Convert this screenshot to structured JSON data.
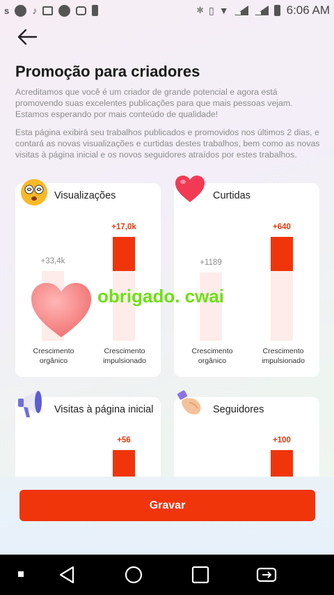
{
  "status_bar": {
    "left_icons": [
      "s-icon",
      "circle-icon",
      "tiktok-icon",
      "gallery-icon",
      "circle-icon",
      "cast-icon",
      "battery-saver-icon"
    ],
    "right_icons": [
      "bluetooth-icon",
      "vibrate-icon",
      "wifi-icon",
      "signal-icon",
      "signal-icon",
      "battery-icon"
    ],
    "time": "6:06 AM"
  },
  "header": {
    "back_icon": "arrow-left-icon",
    "title": "Promoção para criadores",
    "description_1": "Acreditamos que você é um criador de grande potencial e agora está promovendo suas excelentes publicações para que mais pessoas vejam. Estamos esperando por mais conteúdo de qualidade!",
    "description_2": "Esta página exibirá seu trabalhos publicados e promovidos nos últimos 2 dias, e contará as novas visualizações e curtidas destes trabalhos, bem como as novas visitas à página inicial e os novos seguidores atraídos por estes trabalhos."
  },
  "cards": [
    {
      "title": "Visualizações",
      "icon": "dizzy-face-emoji-icon",
      "organic": {
        "label": "+33,4k",
        "fraction": 0.66
      },
      "boosted": {
        "label": "+17,0k",
        "fraction": 1.0
      },
      "caption_organic": [
        "Crescimento",
        "orgânico"
      ],
      "caption_boosted": [
        "Crescimento",
        "impulsionado"
      ]
    },
    {
      "title": "Curtidas",
      "icon": "heart-emoji-icon",
      "organic": {
        "label": "+1189",
        "fraction": 0.66
      },
      "boosted": {
        "label": "+640",
        "fraction": 1.0
      },
      "caption_organic": [
        "Crescimento",
        "orgânico"
      ],
      "caption_boosted": [
        "Crescimento",
        "impulsionado"
      ]
    },
    {
      "title": "Visitas à página inicial",
      "icon": "megaphone-icon",
      "boosted": {
        "label": "+56"
      }
    },
    {
      "title": "Seguidores",
      "icon": "handshake-icon",
      "boosted": {
        "label": "+100"
      }
    }
  ],
  "watermark": {
    "text": "obrigado. cwai",
    "icon": "heart-icon",
    "color": "#6ee011"
  },
  "actions": {
    "save_label": "Gravar"
  },
  "nav_bar": {
    "items": [
      "recents-dot-icon",
      "back-triangle-icon",
      "home-circle-icon",
      "overview-square-icon",
      "screen-rotate-icon"
    ]
  },
  "colors": {
    "accent": "#f0350a",
    "bar_bg": "#fdece9",
    "muted_text": "#8c8c8c"
  }
}
